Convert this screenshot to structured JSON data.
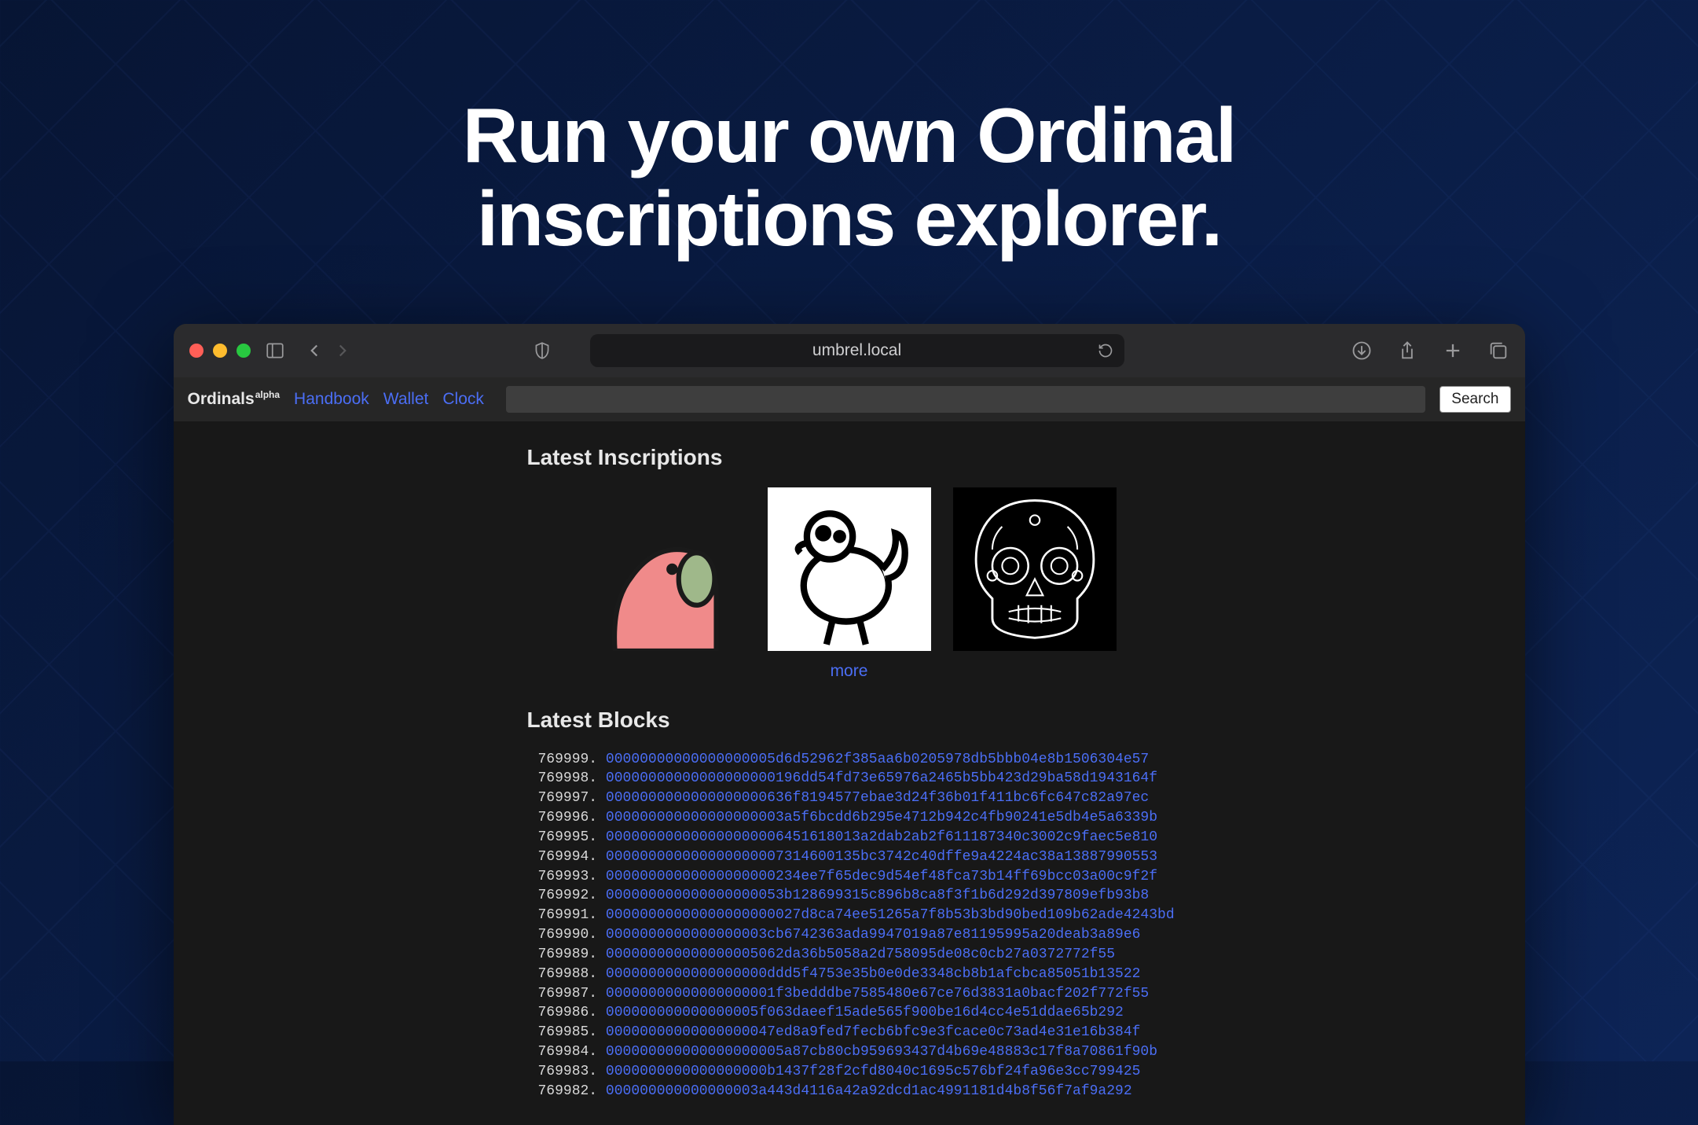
{
  "hero": {
    "title_line1": "Run your own Ordinal",
    "title_line2": "inscriptions explorer."
  },
  "browser": {
    "url": "umbrel.local"
  },
  "topbar": {
    "brand": "Ordinals",
    "brand_sup": "alpha",
    "links": [
      "Handbook",
      "Wallet",
      "Clock"
    ],
    "search_button": "Search"
  },
  "sections": {
    "latest_inscriptions_title": "Latest Inscriptions",
    "more_label": "more",
    "latest_blocks_title": "Latest Blocks"
  },
  "inscriptions": [
    {
      "name": "pink-bird-cartoon"
    },
    {
      "name": "cartoon-bird-thumbs-up"
    },
    {
      "name": "sugar-skull"
    }
  ],
  "blocks": [
    {
      "height": "769999.",
      "hash": "00000000000000000005d6d52962f385aa6b0205978db5bbb04e8b1506304e57"
    },
    {
      "height": "769998.",
      "hash": "00000000000000000000196dd54fd73e65976a2465b5bb423d29ba58d1943164f"
    },
    {
      "height": "769997.",
      "hash": "0000000000000000000636f8194577ebae3d24f36b01f411bc6fc647c82a97ec"
    },
    {
      "height": "769996.",
      "hash": "000000000000000000003a5f6bcdd6b295e4712b942c4fb90241e5db4e5a6339b"
    },
    {
      "height": "769995.",
      "hash": "000000000000000000006451618013a2dab2ab2f611187340c3002c9faec5e810"
    },
    {
      "height": "769994.",
      "hash": "000000000000000000007314600135bc3742c40dffe9a4224ac38a13887990553"
    },
    {
      "height": "769993.",
      "hash": "00000000000000000000234ee7f65dec9d54ef48fca73b14ff69bcc03a00c9f2f"
    },
    {
      "height": "769992.",
      "hash": "000000000000000000053b128699315c896b8ca8f3f1b6d292d397809efb93b8"
    },
    {
      "height": "769991.",
      "hash": "00000000000000000000027d8ca74ee51265a7f8b53b3bd90bed109b62ade4243bd"
    },
    {
      "height": "769990.",
      "hash": "0000000000000000003cb6742363ada9947019a87e81195995a20deab3a89e6"
    },
    {
      "height": "769989.",
      "hash": "000000000000000005062da36b5058a2d758095de08c0cb27a0372772f55"
    },
    {
      "height": "769988.",
      "hash": "0000000000000000000ddd5f4753e35b0e0de3348cb8b1afcbca85051b13522"
    },
    {
      "height": "769987.",
      "hash": "00000000000000000001f3bedddbe7585480e67ce76d3831a0bacf202f772f55"
    },
    {
      "height": "769986.",
      "hash": "000000000000000005f063daeef15ade565f900be16d4cc4e51ddae65b292"
    },
    {
      "height": "769985.",
      "hash": "00000000000000000047ed8a9fed7fecb6bfc9e3fcace0c73ad4e31e16b384f"
    },
    {
      "height": "769984.",
      "hash": "000000000000000000005a87cb80cb959693437d4b69e48883c17f8a70861f90b"
    },
    {
      "height": "769983.",
      "hash": "0000000000000000000b1437f28f2cfd8040c1695c576bf24fa96e3cc799425"
    },
    {
      "height": "769982.",
      "hash": "000000000000000003a443d4116a42a92dcd1ac4991181d4b8f56f7af9a292"
    }
  ]
}
